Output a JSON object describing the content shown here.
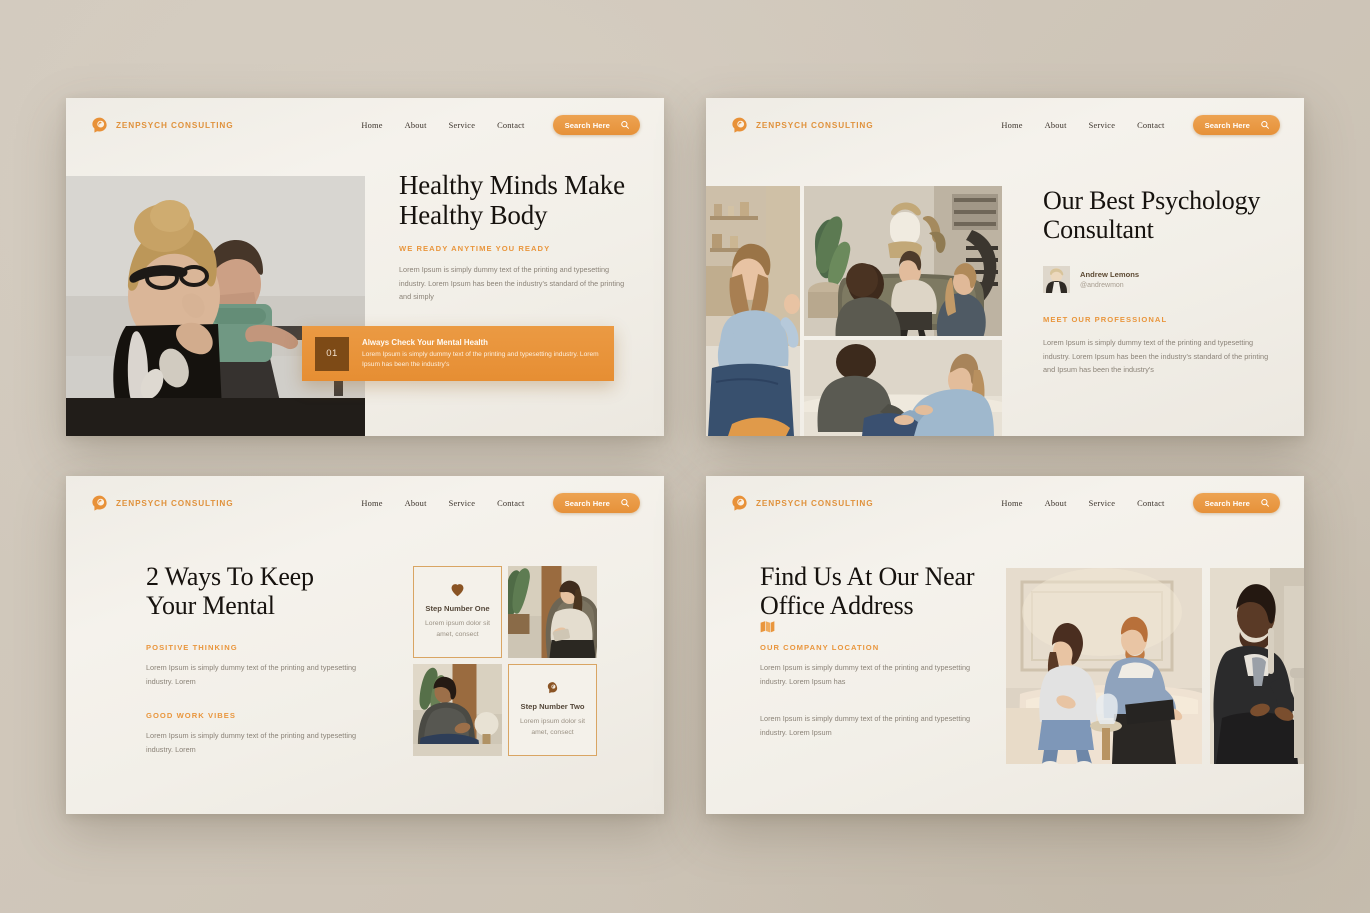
{
  "theme": {
    "accent": "#e9963d",
    "accent_dark": "#7d4a16",
    "card_bg": "#f2efe8",
    "page_bg": "#cfc6b9",
    "heading": "#16120e",
    "body_text": "#8b8378"
  },
  "brand": {
    "name": "ZENPSYCH CONSULTING",
    "logo_icon": "head-brain-icon"
  },
  "nav": {
    "items": [
      "Home",
      "About",
      "Service",
      "Contact"
    ],
    "search": {
      "label": "Search Here",
      "icon": "search-icon"
    }
  },
  "slides": [
    {
      "id": "slide-hero",
      "heading": "Healthy Minds Make Healthy Body",
      "eyebrow": "WE READY ANYTIME YOU READY",
      "body": "Lorem Ipsum is simply dummy text of the printing and typesetting industry. Lorem Ipsum has been the industry's standard of the printing and simply",
      "callout": {
        "number": "01",
        "title": "Always Check Your Mental Health",
        "body": "Lorem Ipsum is simply dummy text of the printing and typesetting industry. Lorem Ipsum has been the industry's"
      }
    },
    {
      "id": "slide-consultant",
      "heading": "Our Best Psychology Consultant",
      "person": {
        "name": "Andrew Lemons",
        "handle": "@andrewmon"
      },
      "eyebrow": "MEET OUR PROFESSIONAL",
      "body": "Lorem Ipsum is simply dummy text of the printing and typesetting industry. Lorem Ipsum has been the industry's standard of the printing and Ipsum has been the industry's"
    },
    {
      "id": "slide-ways",
      "heading": "2 Ways To Keep Your Mental",
      "sections": [
        {
          "eyebrow": "POSITIVE THINKING",
          "body": "Lorem Ipsum is simply dummy text of the printing and typesetting industry. Lorem"
        },
        {
          "eyebrow": "GOOD WORK VIBES",
          "body": "Lorem Ipsum is simply dummy text of the printing and typesetting industry. Lorem"
        }
      ],
      "steps": [
        {
          "icon": "heart-icon",
          "title": "Step Number One",
          "body": "Lorem ipsum dolor sit amet, consect"
        },
        {
          "icon": "head-profile-icon",
          "title": "Step Number Two",
          "body": "Lorem ipsum dolor sit amet, consect"
        }
      ]
    },
    {
      "id": "slide-location",
      "heading": "Find Us At Our Near Office Address",
      "icon": "map-icon",
      "eyebrow": "OUR COMPANY LOCATION",
      "body_1": "Lorem Ipsum is simply dummy text of the printing and typesetting industry. Lorem Ipsum has",
      "body_2": "Lorem Ipsum is simply dummy text of the printing and typesetting industry. Lorem Ipsum"
    }
  ]
}
